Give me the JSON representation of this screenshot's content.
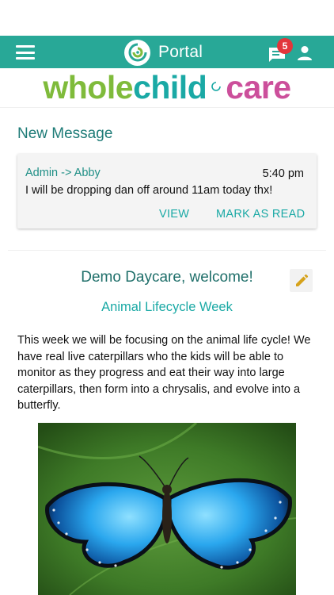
{
  "app": {
    "title": "Portal",
    "notification_count": "5"
  },
  "logo_banner": {
    "word1": "whole",
    "word2": "child",
    "word3": "care"
  },
  "new_message": {
    "section_title": "New Message",
    "from": "Admin -> Abby",
    "time": "5:40 pm",
    "text": "I will be dropping dan off around 11am today thx!",
    "view_label": "VIEW",
    "mark_read_label": "MARK AS READ"
  },
  "post": {
    "title": "Demo Daycare, welcome!",
    "subtitle": "Animal Lifecycle Week",
    "body": "This week we will be focusing on the animal life cycle! We have real live caterpillars who the kids will be able to monitor as they progress and eat their way into large caterpillars, then form into a chrysalis, and evolve into a butterfly."
  },
  "icons": {
    "menu": "menu-icon",
    "logo": "logo-icon",
    "chat": "chat-icon",
    "user": "user-icon",
    "edit": "pencil-icon",
    "photo": "butterfly-photo"
  },
  "colors": {
    "primary": "#28a897",
    "badge": "#e2363b",
    "accent_text": "#1aa9a5",
    "logo_green": "#7fbb3b",
    "logo_teal": "#1aa9a5",
    "logo_pink": "#cc4f9b",
    "edit_pencil": "#d6a21b"
  }
}
